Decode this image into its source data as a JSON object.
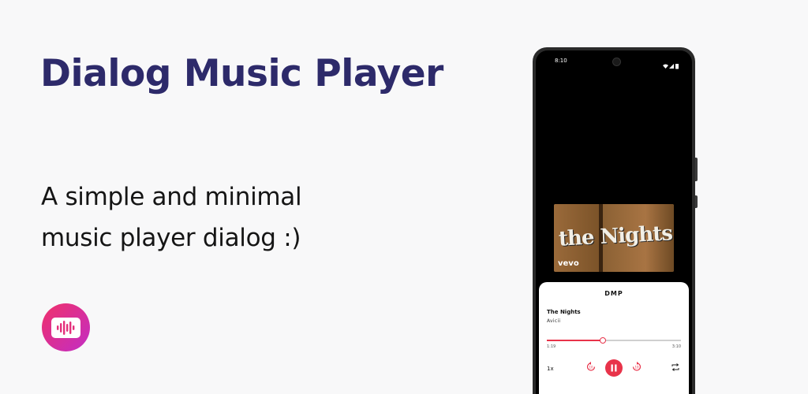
{
  "headline": "Dialog Music Player",
  "tagline_lines": [
    "A simple and minimal",
    "music player dialog :)"
  ],
  "icons": {
    "app": "waveform-card-icon",
    "camera": "front-camera-icon",
    "wifi": "wifi-icon",
    "signal": "cellular-signal-icon",
    "battery": "battery-icon",
    "rewind": "replay-10-icon",
    "pause": "pause-icon",
    "forward": "forward-10-icon",
    "repeat": "repeat-icon"
  },
  "colors": {
    "title": "#2d2a6a",
    "accent": "#e8334a",
    "icon_gradient_start": "#f0306a",
    "icon_gradient_end": "#c22ec5"
  },
  "phone": {
    "status_time": "8:10",
    "album": {
      "art_text": "the Nights",
      "watermark": "vevo"
    },
    "dialog": {
      "title": "DMP",
      "song": "The Nights",
      "artist": "Avicii",
      "elapsed": "1:19",
      "duration": "3:10",
      "progress": 0.42,
      "speed": "1x"
    }
  }
}
